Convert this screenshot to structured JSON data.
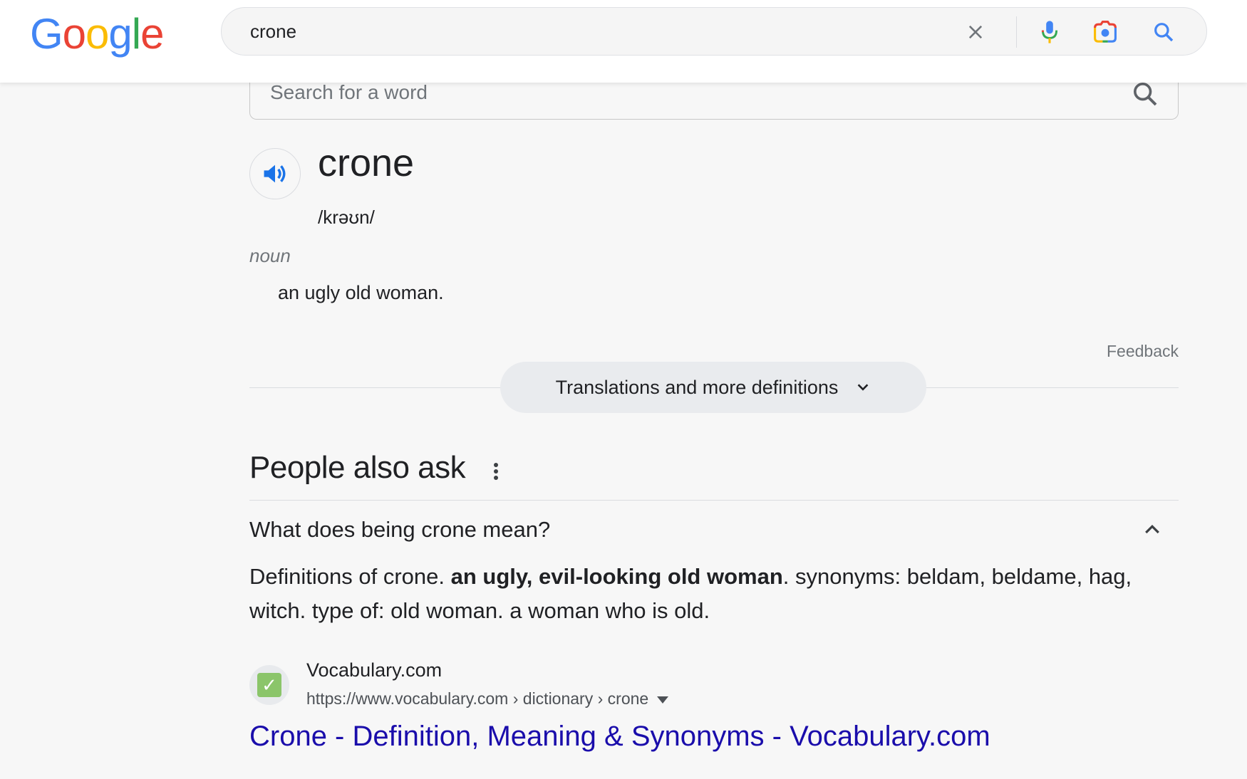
{
  "header": {
    "logo_letters": [
      {
        "ch": "G",
        "color": "#4285F4"
      },
      {
        "ch": "o",
        "color": "#EA4335"
      },
      {
        "ch": "o",
        "color": "#FBBC05"
      },
      {
        "ch": "g",
        "color": "#4285F4"
      },
      {
        "ch": "l",
        "color": "#34A853"
      },
      {
        "ch": "e",
        "color": "#EA4335"
      }
    ],
    "search_value": "crone",
    "icons": [
      "close-icon",
      "microphone-icon",
      "camera-lens-icon",
      "search-icon"
    ]
  },
  "dictionary": {
    "search_placeholder": "Search for a word",
    "word": "crone",
    "phonetic": "/krəʊn/",
    "part_of_speech": "noun",
    "definition": "an ugly old woman.",
    "feedback_label": "Feedback",
    "more_button_label": "Translations and more definitions"
  },
  "people_also_ask": {
    "title": "People also ask",
    "question": "What does being crone mean?",
    "answer_prefix": "Definitions of crone. ",
    "answer_bold": "an ugly, evil-looking old woman",
    "answer_suffix": ". synonyms: beldam, beldame, hag, witch. type of: old woman. a woman who is old.",
    "source": {
      "site_name": "Vocabulary.com",
      "url": "https://www.vocabulary.com › dictionary › crone",
      "favicon_glyph": "✓",
      "result_title": "Crone - Definition, Meaning & Synonyms - Vocabulary.com"
    }
  },
  "colors": {
    "link": "#1a0dab",
    "accent_blue": "#4285F4"
  }
}
